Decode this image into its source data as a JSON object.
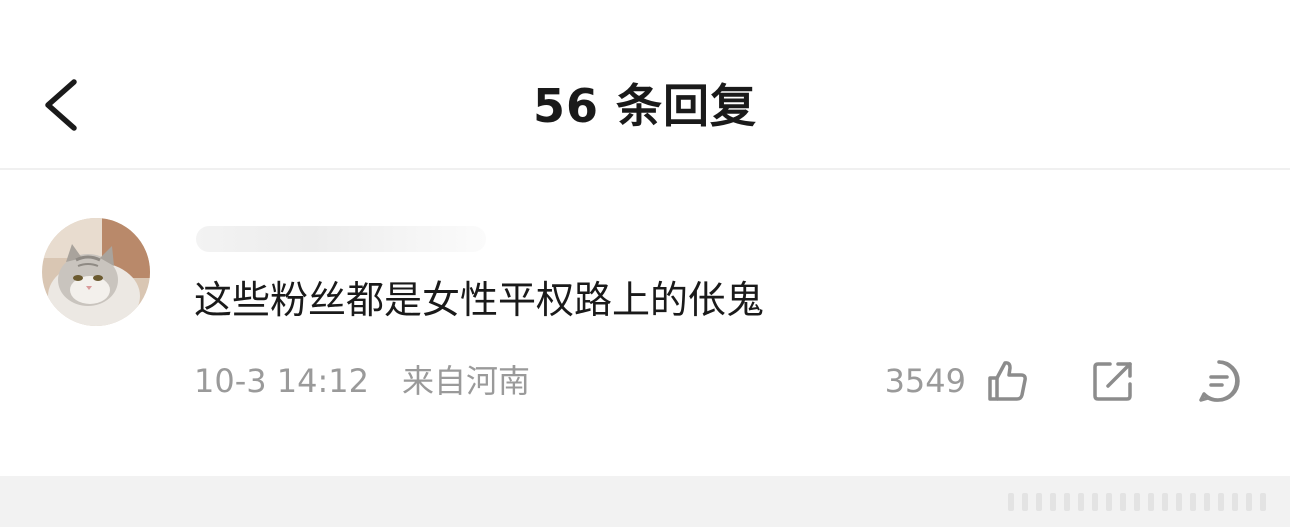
{
  "header": {
    "title": "56 条回复",
    "back_icon": "chevron-left-icon"
  },
  "comment": {
    "avatar": "cat-avatar",
    "text": "这些粉丝都是女性平权路上的伥鬼",
    "time": "10-3 14:12",
    "location": "来自河南",
    "like_count": "3549",
    "icons": {
      "like": "thumbs-up-icon",
      "share": "share-icon",
      "reply": "comment-icon"
    }
  },
  "colors": {
    "text_primary": "#1a1a1a",
    "text_secondary": "#9a9a9a",
    "icon": "#8c8c8c",
    "divider": "#f0f0f0"
  }
}
